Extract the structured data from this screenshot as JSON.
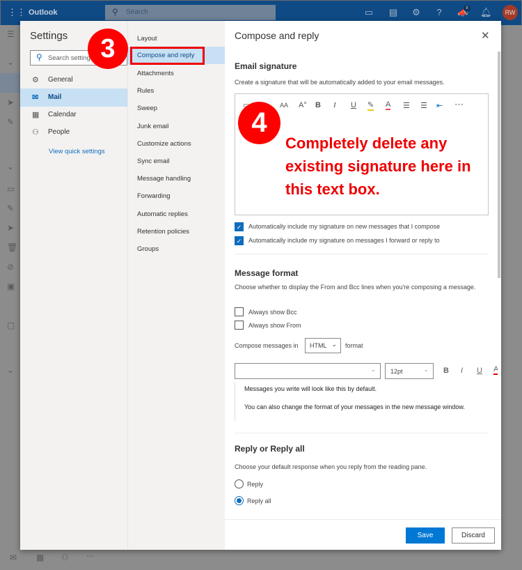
{
  "app": {
    "title": "Outlook",
    "search_placeholder": "Search",
    "avatar": "RW",
    "notif_count": "8"
  },
  "settings": {
    "title": "Settings",
    "search_placeholder": "Search settings",
    "categories": [
      {
        "label": "General",
        "icon": "gear-icon"
      },
      {
        "label": "Mail",
        "icon": "mail-icon"
      },
      {
        "label": "Calendar",
        "icon": "calendar-icon"
      },
      {
        "label": "People",
        "icon": "people-icon"
      }
    ],
    "quick_link": "View quick settings",
    "mail_items": [
      "Layout",
      "Compose and reply",
      "Attachments",
      "Rules",
      "Sweep",
      "Junk email",
      "Customize actions",
      "Sync email",
      "Message handling",
      "Forwarding",
      "Automatic replies",
      "Retention policies",
      "Groups"
    ]
  },
  "pane": {
    "title": "Compose and reply",
    "signature": {
      "heading": "Email signature",
      "desc": "Create a signature that will be automatically added to your email messages.",
      "opt_new": "Automatically include my signature on new messages that I compose",
      "opt_reply": "Automatically include my signature on messages I forward or reply to"
    },
    "format": {
      "heading": "Message format",
      "desc": "Choose whether to display the From and Bcc lines when you're composing a message.",
      "bcc": "Always show Bcc",
      "from": "Always show From",
      "compose_label": "Compose messages in",
      "compose_value": "HTML",
      "compose_suffix": "format",
      "font_size": "12pt",
      "preview1": "Messages you write will look like this by default.",
      "preview2": "You can also change the format of your messages in the new message window."
    },
    "reply": {
      "heading": "Reply or Reply all",
      "desc": "Choose your default response when you reply from the reading pane.",
      "opt1": "Reply",
      "opt2": "Reply all"
    },
    "save": "Save",
    "discard": "Discard"
  },
  "annotations": {
    "step3": "3",
    "step4": "4",
    "note": "Completely delete any existing signature here in this text box."
  },
  "colors": {
    "accent": "#0078d4",
    "annotation": "#ff0000"
  }
}
